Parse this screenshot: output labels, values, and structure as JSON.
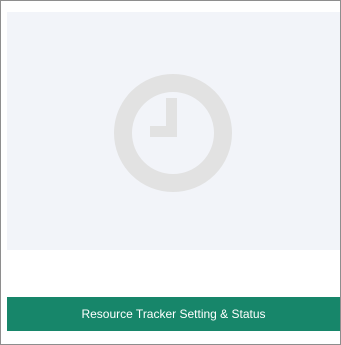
{
  "tile": {
    "label": "Resource Tracker Setting & Status",
    "icon": "clock-icon",
    "accent_color": "#17866a",
    "preview_background": "#f2f4f9",
    "icon_color": "#e2e2e2"
  }
}
